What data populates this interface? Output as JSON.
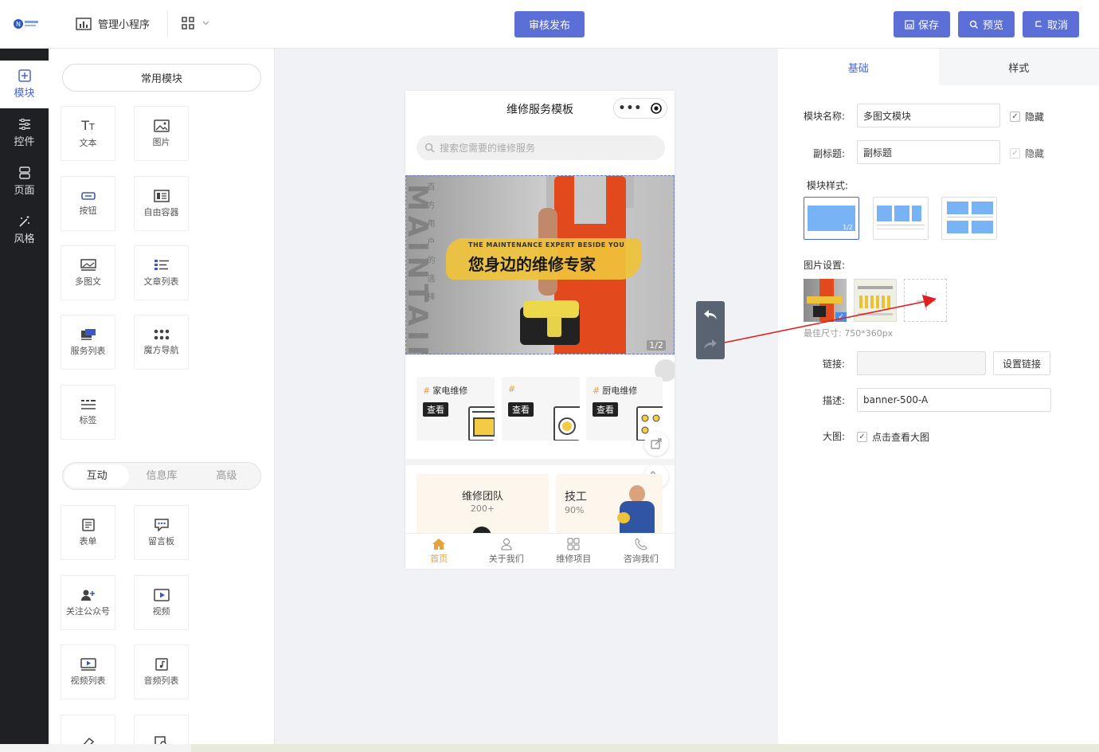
{
  "header": {
    "manage_label": "管理小程序",
    "publish_label": "审核发布",
    "save_label": "保存",
    "preview_label": "预览",
    "cancel_label": "取消"
  },
  "sidebar": {
    "items": [
      {
        "label": "模块",
        "icon": "plus-square-icon"
      },
      {
        "label": "控件",
        "icon": "sliders-icon"
      },
      {
        "label": "页面",
        "icon": "pages-icon"
      },
      {
        "label": "风格",
        "icon": "magic-wand-icon"
      }
    ]
  },
  "modules": {
    "common_label": "常用模块",
    "common": [
      "文本",
      "图片",
      "按钮",
      "自由容器",
      "多图文",
      "文章列表",
      "服务列表",
      "魔方导航",
      "标签"
    ],
    "tabs": [
      "互动",
      "信息库",
      "高级"
    ],
    "interactive": [
      "表单",
      "留言板",
      "关注公众号",
      "视频",
      "视频列表",
      "音频列表"
    ]
  },
  "phone": {
    "title": "维修服务模板",
    "search_placeholder": "搜索您需要的维修服务",
    "banner_en": "THE MAINTENANCE EXPERT BESIDE YOU",
    "banner_cn": "您身边的维修专家",
    "banner_vertical": "百方用户的选择",
    "banner_bg_text": "MAINTAIN",
    "banner_counter": "1/2",
    "cards": [
      {
        "title": "家电维修",
        "button": "查看"
      },
      {
        "title": "",
        "button": "查看"
      },
      {
        "title": "厨电维修",
        "button": "查看"
      }
    ],
    "team": {
      "title": "维修团队",
      "count": "200+"
    },
    "tech": {
      "title": "技工",
      "percent": "90%"
    },
    "tabbar": [
      "首页",
      "关于我们",
      "维修项目",
      "咨询我们"
    ]
  },
  "panel": {
    "tabs": [
      "基础",
      "样式"
    ],
    "name_label": "模块名称:",
    "name_value": "多图文模块",
    "hide_label": "隐藏",
    "subtitle_label": "副标题:",
    "subtitle_value": "副标题",
    "style_label": "模块样式:",
    "style_badge": "1/2",
    "image_label": "图片设置:",
    "image_size": "最佳尺寸: 750*360px",
    "link_label": "链接:",
    "set_link_label": "设置链接",
    "desc_label": "描述:",
    "desc_value": "banner-500-A",
    "big_label": "大图:",
    "big_check_label": "点击查看大图"
  },
  "colors": {
    "accent": "#5b6fd6",
    "sidebar": "#1f2024",
    "brand_orange": "#e6a23c",
    "annotation": "#e02020"
  }
}
